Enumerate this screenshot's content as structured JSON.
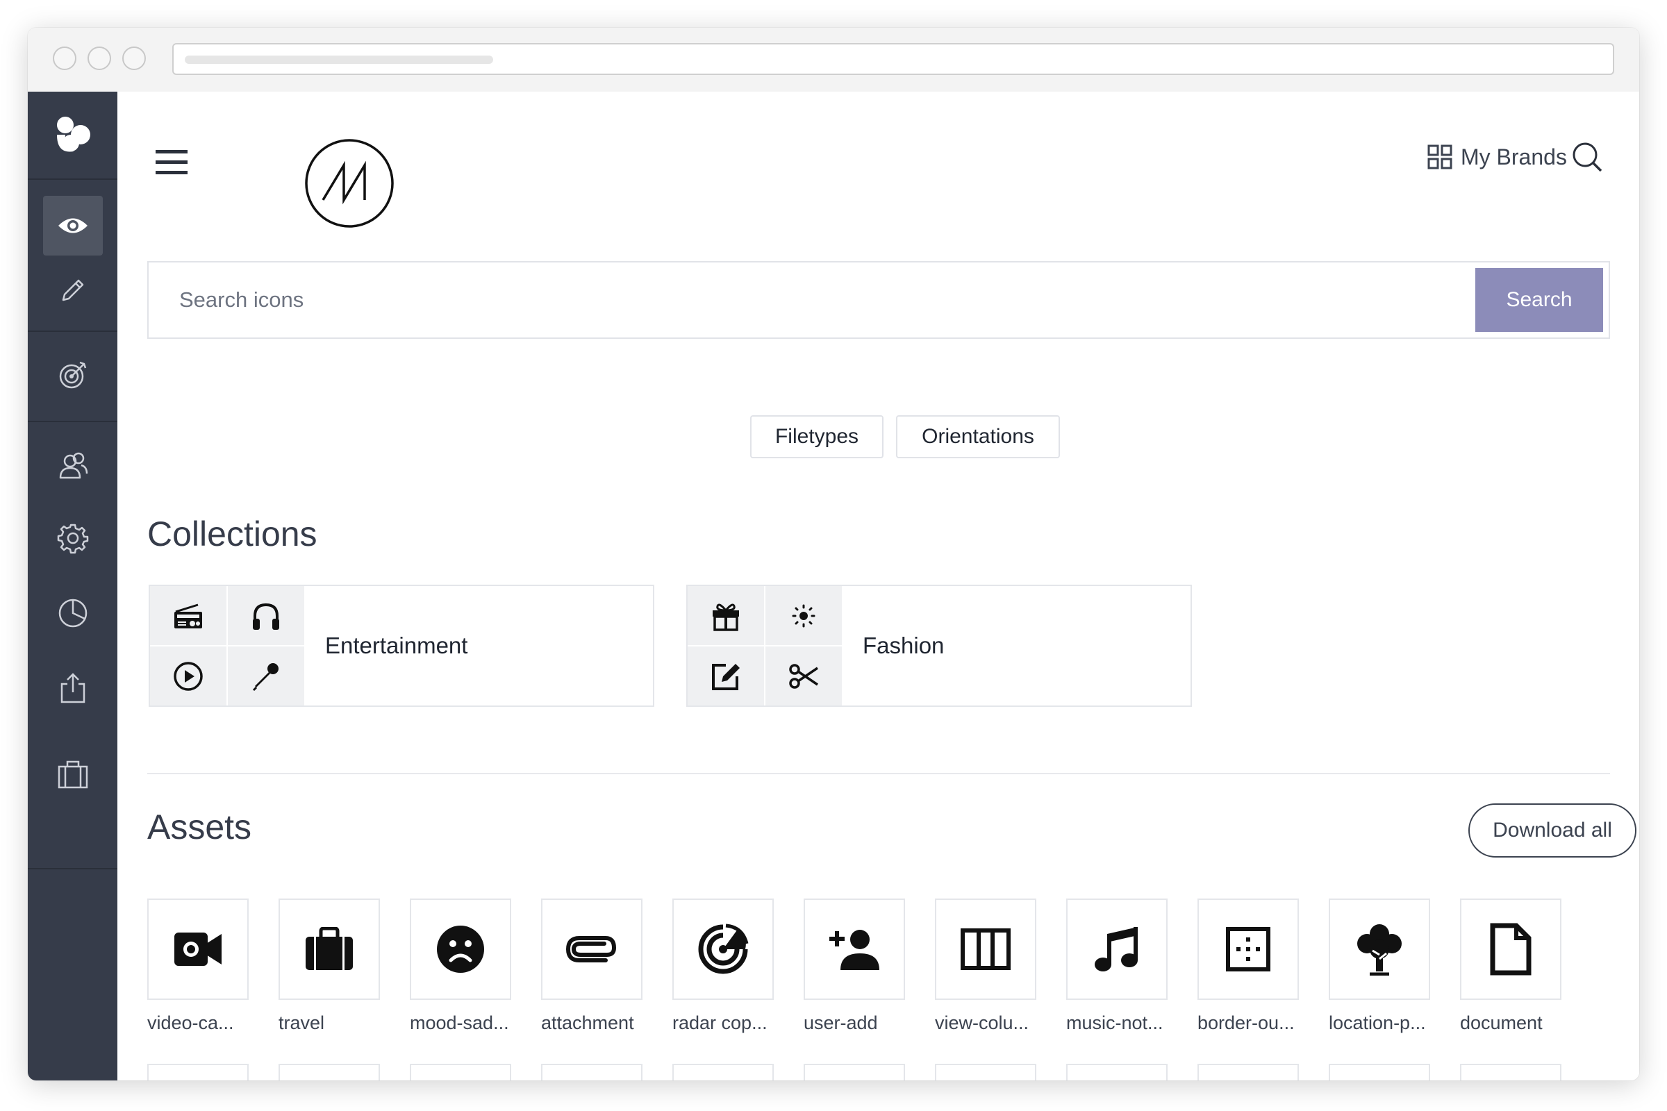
{
  "header": {
    "my_brands_label": "My Brands",
    "search_placeholder": "Search icons",
    "search_button_label": "Search"
  },
  "filters": [
    {
      "label": "Filetypes"
    },
    {
      "label": "Orientations"
    }
  ],
  "collections_title": "Collections",
  "collections": [
    {
      "label": "Entertainment",
      "icons": [
        "radio-icon",
        "headphones-icon",
        "play-circle-icon",
        "microphone-icon"
      ]
    },
    {
      "label": "Fashion",
      "icons": [
        "gift-icon",
        "sun-icon",
        "edit-icon",
        "scissors-icon"
      ]
    }
  ],
  "assets_title": "Assets",
  "download_all_label": "Download all",
  "assets": [
    {
      "label": "video-ca...",
      "icon": "video-camera-icon"
    },
    {
      "label": "travel",
      "icon": "briefcase-icon"
    },
    {
      "label": "mood-sad...",
      "icon": "sad-face-icon"
    },
    {
      "label": "attachment",
      "icon": "paperclip-icon"
    },
    {
      "label": "radar cop...",
      "icon": "radar-icon"
    },
    {
      "label": "user-add",
      "icon": "user-add-icon"
    },
    {
      "label": "view-colu...",
      "icon": "view-column-icon"
    },
    {
      "label": "music-not...",
      "icon": "music-note-icon"
    },
    {
      "label": "border-ou...",
      "icon": "border-outer-icon"
    },
    {
      "label": "location-p...",
      "icon": "tree-icon"
    },
    {
      "label": "document",
      "icon": "document-icon"
    }
  ],
  "sidebar": {
    "items": [
      {
        "icon": "eye-icon",
        "active": true
      },
      {
        "icon": "pencil-icon"
      },
      {
        "icon": "target-icon"
      },
      {
        "icon": "users-icon"
      },
      {
        "icon": "gear-icon"
      },
      {
        "icon": "pie-chart-icon"
      },
      {
        "icon": "share-icon"
      },
      {
        "icon": "briefcase-icon"
      }
    ]
  },
  "colors": {
    "sidebar_bg": "#363c4a",
    "accent": "#8c8cb9",
    "text_dark": "#363c4a"
  }
}
